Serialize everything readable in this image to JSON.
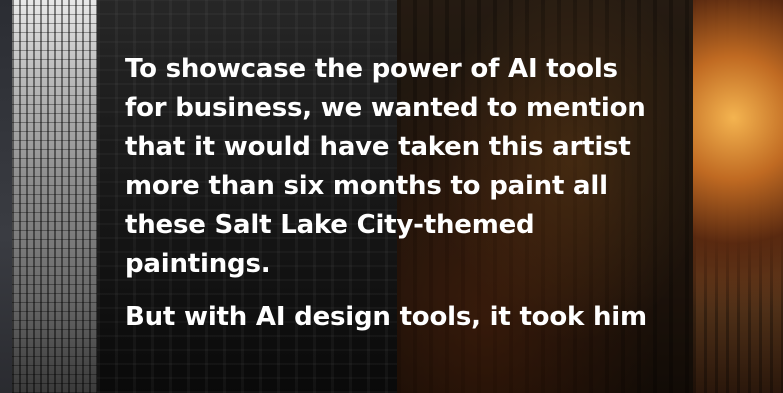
{
  "article": {
    "paragraphs": [
      "To showcase the power of AI tools for business, we wanted to mention that it would have taken this artist more than six months to paint all these Salt Lake City-themed paintings.",
      "But with AI design tools, it took him"
    ]
  }
}
